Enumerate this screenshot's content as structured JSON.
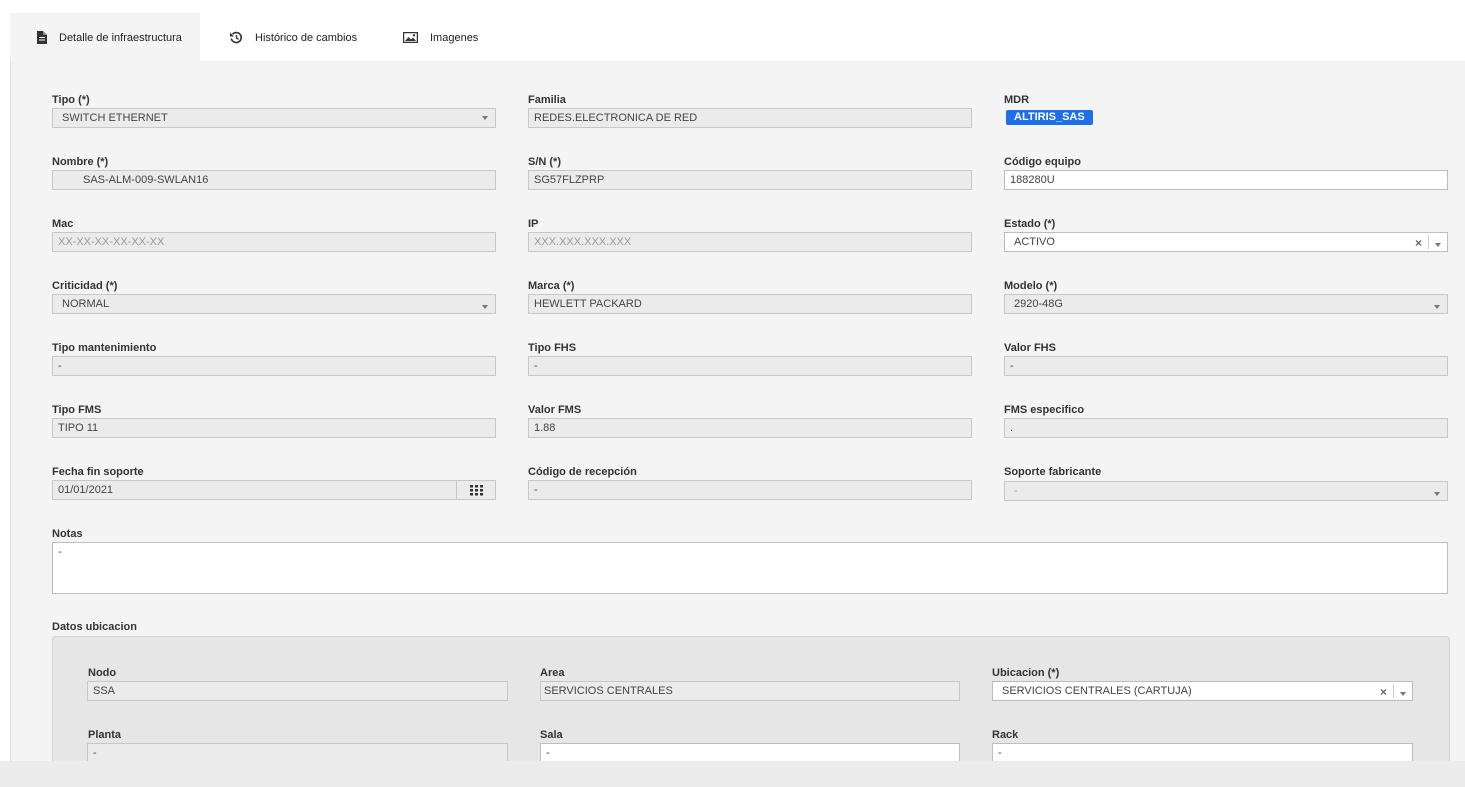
{
  "tabs": [
    {
      "label": "Detalle de infraestructura",
      "icon": "document-icon"
    },
    {
      "label": "Histórico de cambios",
      "icon": "history-icon"
    },
    {
      "label": "Imagenes",
      "icon": "image-icon"
    }
  ],
  "form": {
    "tipo": {
      "label": "Tipo (*)",
      "value": "SWITCH ETHERNET"
    },
    "familia": {
      "label": "Familia",
      "value": "REDES.ELECTRONICA DE RED"
    },
    "mdr": {
      "label": "MDR",
      "value": "ALTIRIS_SAS"
    },
    "nombre": {
      "label": "Nombre (*)",
      "value": "SAS-ALM-009-SWLAN16"
    },
    "sn": {
      "label": "S/N (*)",
      "value": "SG57FLZPRP"
    },
    "codigo_equipo": {
      "label": "Código equipo",
      "value": "188280U"
    },
    "mac": {
      "label": "Mac",
      "placeholder": "XX-XX-XX-XX-XX-XX"
    },
    "ip": {
      "label": "IP",
      "placeholder": "XXX.XXX.XXX.XXX"
    },
    "estado": {
      "label": "Estado (*)",
      "value": "ACTIVO"
    },
    "criticidad": {
      "label": "Criticidad (*)",
      "value": "NORMAL"
    },
    "marca": {
      "label": "Marca (*)",
      "value": "HEWLETT PACKARD"
    },
    "modelo": {
      "label": "Modelo (*)",
      "value": "2920-48G"
    },
    "tipo_mantenimiento": {
      "label": "Tipo mantenimiento",
      "value": "-"
    },
    "tipo_fhs": {
      "label": "Tipo FHS",
      "value": "-"
    },
    "valor_fhs": {
      "label": "Valor FHS",
      "value": "-"
    },
    "tipo_fms": {
      "label": "Tipo FMS",
      "value": "TIPO 11"
    },
    "valor_fms": {
      "label": "Valor FMS",
      "value": "1.88"
    },
    "fms_especifico": {
      "label": "FMS especifico",
      "value": "."
    },
    "fecha_fin_soporte": {
      "label": "Fecha fin soporte",
      "value": "01/01/2021"
    },
    "codigo_recepcion": {
      "label": "Código de recepción",
      "value": "-"
    },
    "soporte_fabricante": {
      "label": "Soporte fabricante",
      "value": "-"
    },
    "notas": {
      "label": "Notas",
      "value": "-"
    }
  },
  "ubicacion": {
    "title": "Datos ubicacion",
    "nodo": {
      "label": "Nodo",
      "value": "SSA"
    },
    "area": {
      "label": "Area",
      "value": "SERVICIOS CENTRALES"
    },
    "ubicacion": {
      "label": "Ubicacion (*)",
      "value": "SERVICIOS CENTRALES (CARTUJA)"
    },
    "planta": {
      "label": "Planta",
      "value": "-"
    },
    "sala": {
      "label": "Sala",
      "value": "-"
    },
    "rack": {
      "label": "Rack",
      "value": "-"
    }
  },
  "colors": {
    "accent": "#1e6fe8",
    "panel": "#f4f4f4",
    "readonly": "#ebebeb"
  }
}
